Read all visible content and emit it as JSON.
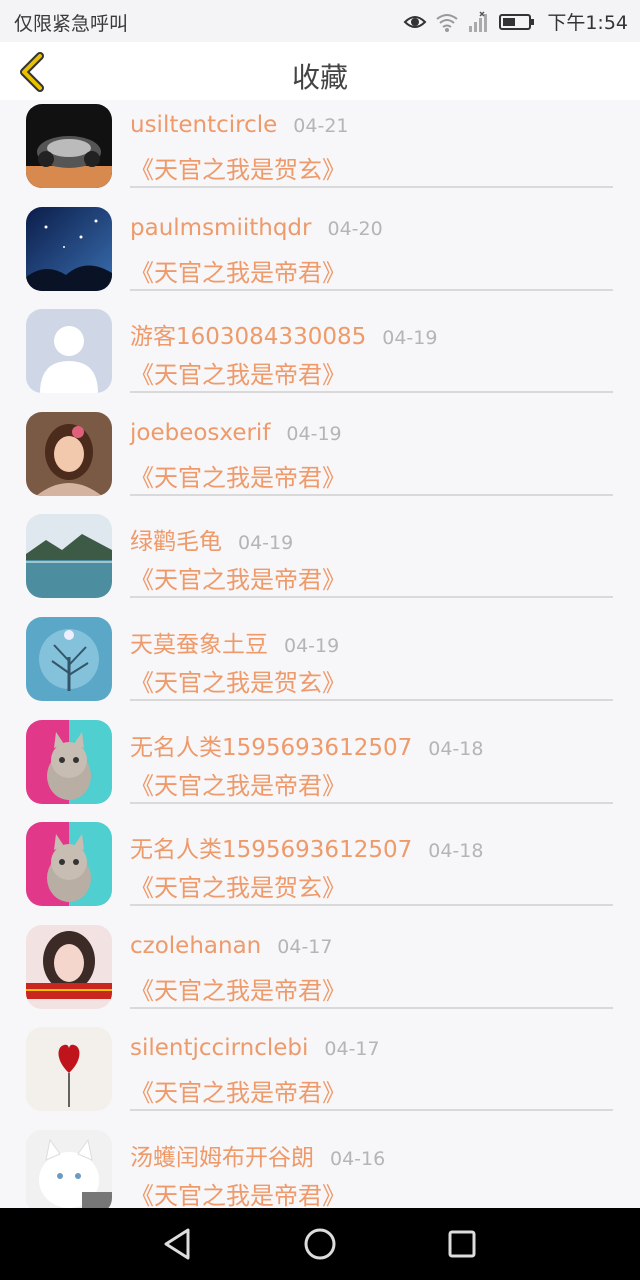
{
  "status_bar": {
    "carrier": "仅限紧急呼叫",
    "time": "下午1:54",
    "icons": [
      "eye-icon",
      "wifi-icon",
      "signal-icon",
      "battery-icon"
    ]
  },
  "header": {
    "title": "收藏",
    "back_icon": "chevron-left-icon"
  },
  "favorites": [
    {
      "user": "usiltentcircle",
      "date": "04-21",
      "book": "《天官之我是贺玄》",
      "avatar": "car"
    },
    {
      "user": "paulmsmiithqdr",
      "date": "04-20",
      "book": "《天官之我是帝君》",
      "avatar": "night-sky"
    },
    {
      "user": "游客1603084330085",
      "date": "04-19",
      "book": "《天官之我是帝君》",
      "avatar": "default-person"
    },
    {
      "user": "joebeosxerif",
      "date": "04-19",
      "book": "《天官之我是帝君》",
      "avatar": "girl"
    },
    {
      "user": "绿鹳毛龟",
      "date": "04-19",
      "book": "《天官之我是帝君》",
      "avatar": "lake"
    },
    {
      "user": "天莫蚕象土豆",
      "date": "04-19",
      "book": "《天官之我是贺玄》",
      "avatar": "snow-tree"
    },
    {
      "user": "无名人类1595693612507",
      "date": "04-18",
      "book": "《天官之我是帝君》",
      "avatar": "kitten"
    },
    {
      "user": "无名人类1595693612507",
      "date": "04-18",
      "book": "《天官之我是贺玄》",
      "avatar": "kitten"
    },
    {
      "user": "czolehanan",
      "date": "04-17",
      "book": "《天官之我是帝君》",
      "avatar": "woman"
    },
    {
      "user": "silentjccirnclebi",
      "date": "04-17",
      "book": "《天官之我是帝君》",
      "avatar": "heart-balloon"
    },
    {
      "user": "汤蠖闰姆布开谷朗",
      "date": "04-16",
      "book": "《天官之我是帝君》",
      "avatar": "white-cat"
    }
  ],
  "nav_bar": {
    "icons": [
      "back-triangle-icon",
      "home-circle-icon",
      "recents-square-icon"
    ]
  },
  "colors": {
    "accent": "#ee9a6a",
    "date": "#b5b5b5",
    "back_arrow": "#e8c100"
  }
}
